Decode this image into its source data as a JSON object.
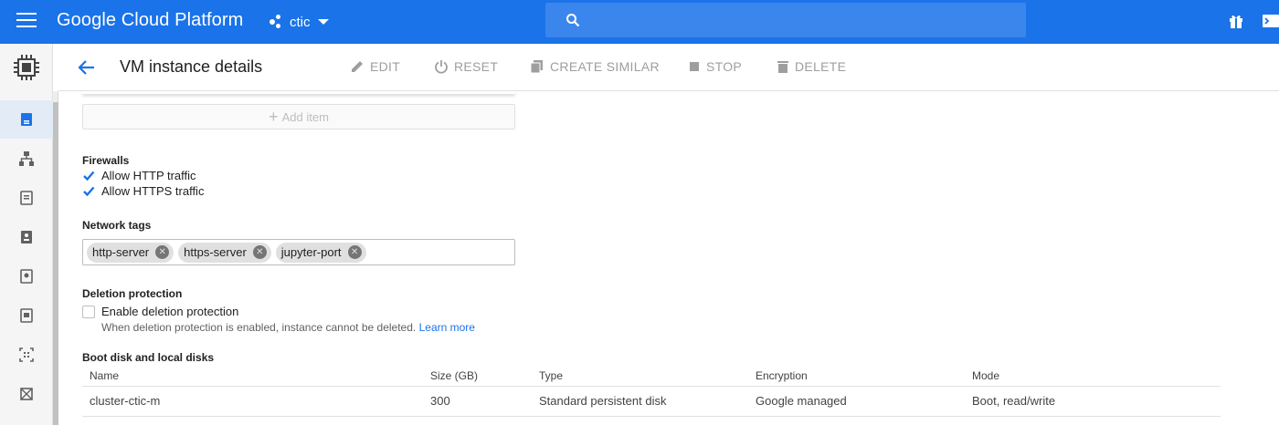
{
  "app": {
    "title": "Google Cloud Platform",
    "project": "ctic"
  },
  "header": {
    "title": "VM instance details",
    "actions": [
      {
        "label": "EDIT",
        "icon": "pencil-icon"
      },
      {
        "label": "RESET",
        "icon": "power-icon"
      },
      {
        "label": "CREATE SIMILAR",
        "icon": "copy-icon"
      },
      {
        "label": "STOP",
        "icon": "stop-icon"
      },
      {
        "label": "DELETE",
        "icon": "trash-icon"
      }
    ]
  },
  "content": {
    "add_item_label": "Add item",
    "firewalls": {
      "label": "Firewalls",
      "options": [
        {
          "label": "Allow HTTP traffic",
          "checked": true
        },
        {
          "label": "Allow HTTPS traffic",
          "checked": true
        }
      ]
    },
    "network_tags": {
      "label": "Network tags",
      "tags": [
        "http-server",
        "https-server",
        "jupyter-port"
      ]
    },
    "deletion_protection": {
      "label": "Deletion protection",
      "checkbox_label": "Enable deletion protection",
      "checked": false,
      "hint": "When deletion protection is enabled, instance cannot be deleted.",
      "learn_more": "Learn more"
    },
    "disks": {
      "label": "Boot disk and local disks",
      "columns": [
        "Name",
        "Size (GB)",
        "Type",
        "Encryption",
        "Mode"
      ],
      "rows": [
        [
          "cluster-ctic-m",
          "300",
          "Standard persistent disk",
          "Google managed",
          "Boot, read/write"
        ]
      ]
    }
  },
  "colors": {
    "brand": "#1a73e8",
    "checkbox": "#1a73e8",
    "link": "#1a73e8",
    "disabled_text": "#9e9e9e"
  }
}
